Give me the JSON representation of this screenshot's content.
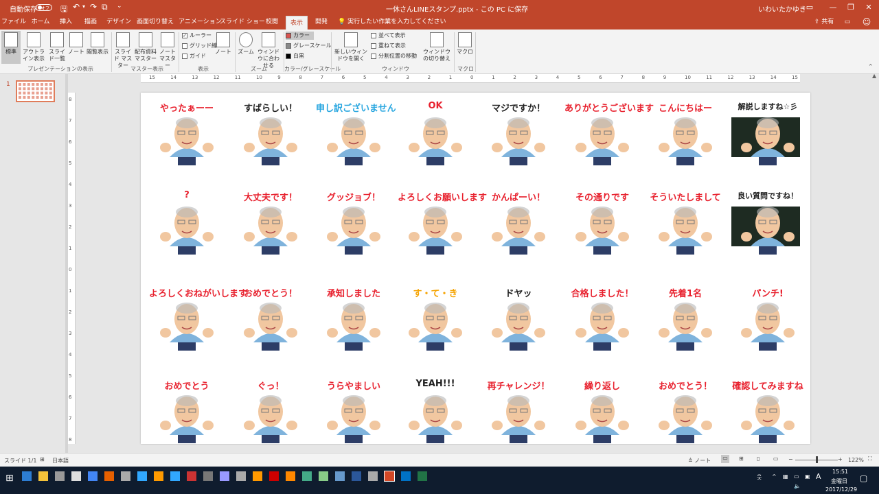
{
  "title_bar": {
    "autosave_label": "自動保存",
    "autosave_state": "オフ",
    "doc_title": "一休さんLINEスタンプ.pptx  -  この PC に保存",
    "user_name": "いわいたかゆき"
  },
  "tabs": [
    "ファイル",
    "ホーム",
    "挿入",
    "描画",
    "デザイン",
    "画面切り替え",
    "アニメーション",
    "スライド ショー",
    "校閲",
    "表示",
    "開発"
  ],
  "active_tab": "表示",
  "tell_me": "実行したい作業を入力してください",
  "share_label": "共有",
  "ribbon": {
    "presentation_views": {
      "group": "プレゼンテーションの表示",
      "buttons": [
        "標準",
        "アウトライン表示",
        "スライド一覧",
        "ノート",
        "閲覧表示"
      ]
    },
    "master_views": {
      "group": "マスター表示",
      "buttons": [
        "スライド マスター",
        "配布資料マスター",
        "ノート マスター"
      ]
    },
    "show": {
      "group": "表示",
      "ruler": "ルーラー",
      "gridlines": "グリッド線",
      "guides": "ガイド",
      "notes": "ノート"
    },
    "zoom": {
      "group": "ズーム",
      "zoom": "ズーム",
      "fit": "ウィンドウに合わせる"
    },
    "color": {
      "group": "カラー/グレースケール",
      "color": "カラー",
      "grayscale": "グレースケール",
      "bw": "白黒"
    },
    "window": {
      "group": "ウィンドウ",
      "new_window": "新しいウィンドウを開く",
      "arrange_all": "並べて表示",
      "cascade": "重ねて表示",
      "move_split": "分割位置の移動",
      "switch": "ウィンドウの切り替え"
    },
    "macros": {
      "group": "マクロ",
      "macro": "マクロ"
    }
  },
  "ruler_h": [
    "15",
    "14",
    "13",
    "12",
    "11",
    "10",
    "9",
    "8",
    "7",
    "6",
    "5",
    "4",
    "3",
    "2",
    "1",
    "0",
    "1",
    "2",
    "3",
    "4",
    "5",
    "6",
    "7",
    "8",
    "9",
    "10",
    "11",
    "12",
    "13",
    "14",
    "15"
  ],
  "ruler_v": [
    "8",
    "7",
    "6",
    "5",
    "4",
    "3",
    "2",
    "1",
    "0",
    "1",
    "2",
    "3",
    "4",
    "5",
    "6",
    "7",
    "8"
  ],
  "slide_number": "1",
  "stickers": [
    {
      "text": "やったぁーー",
      "color": "#e8212e"
    },
    {
      "text": "すばらしい！",
      "color": "#222222"
    },
    {
      "text": "申し訳ございません",
      "color": "#2aa7e0"
    },
    {
      "text": "OK",
      "color": "#e8212e"
    },
    {
      "text": "マジですか！",
      "color": "#222222"
    },
    {
      "text": "ありがとうございます",
      "color": "#e8212e"
    },
    {
      "text": "こんにちはー",
      "color": "#e8212e"
    },
    {
      "text": "解説しますね☆彡",
      "color": "#222222"
    },
    {
      "text": "?",
      "color": "#e8212e"
    },
    {
      "text": "大丈夫です！",
      "color": "#e8212e"
    },
    {
      "text": "グッジョブ！",
      "color": "#e8212e"
    },
    {
      "text": "よろしくお願いします",
      "color": "#e8212e"
    },
    {
      "text": "かんぱーい！",
      "color": "#e8212e"
    },
    {
      "text": "その通りです",
      "color": "#e8212e"
    },
    {
      "text": "そういたしまして",
      "color": "#e8212e"
    },
    {
      "text": "良い質問ですね！",
      "color": "#222222"
    },
    {
      "text": "よろしくおねがいします",
      "color": "#e8212e"
    },
    {
      "text": "おめでとう！",
      "color": "#e8212e"
    },
    {
      "text": "承知しました",
      "color": "#e8212e"
    },
    {
      "text": "す・て・き",
      "color": "#f5a300"
    },
    {
      "text": "ドヤッ",
      "color": "#222222"
    },
    {
      "text": "合格しました！",
      "color": "#e8212e"
    },
    {
      "text": "先着1名",
      "color": "#e8212e"
    },
    {
      "text": "パンチ!",
      "color": "#e8212e"
    },
    {
      "text": "おめでとう",
      "color": "#e8212e"
    },
    {
      "text": "ぐっ！",
      "color": "#e8212e"
    },
    {
      "text": "うらやましい",
      "color": "#e8212e"
    },
    {
      "text": "YEAH!!!",
      "color": "#222222"
    },
    {
      "text": "再チャレンジ！",
      "color": "#e8212e"
    },
    {
      "text": "繰り返し",
      "color": "#e8212e"
    },
    {
      "text": "おめでとう！",
      "color": "#e8212e"
    },
    {
      "text": "確認してみますね",
      "color": "#e8212e"
    }
  ],
  "status_bar": {
    "slide_info": "スライド 1/1",
    "language": "日本語",
    "notes": "ノート",
    "zoom_level": "122%"
  },
  "taskbar": {
    "time": "15:51",
    "day": "金曜日",
    "date": "2017/12/29"
  },
  "colors": {
    "accent": "#c0462b",
    "ribbon_bg": "#f3f3f3",
    "taskbar": "#0f1c2e"
  }
}
